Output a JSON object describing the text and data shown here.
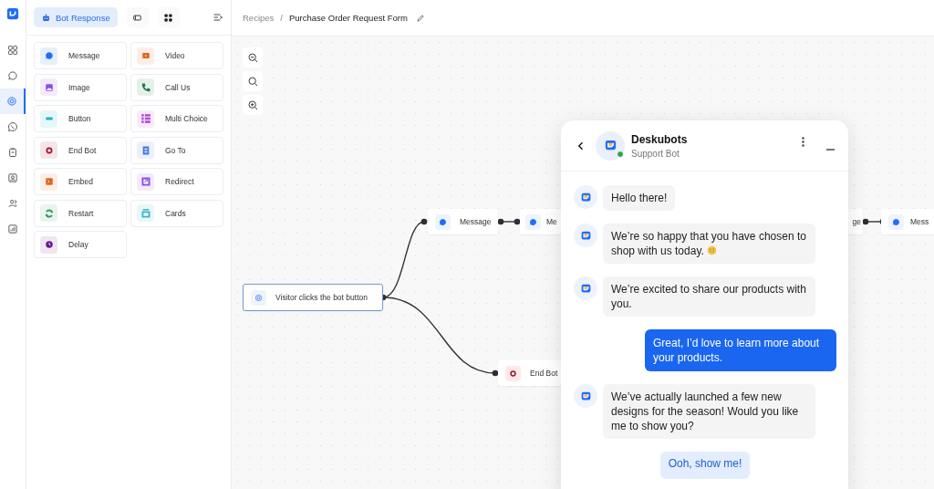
{
  "rail": {
    "items": [
      {
        "kind": "grid",
        "selected": false
      },
      {
        "kind": "chat",
        "selected": false
      },
      {
        "kind": "bot",
        "selected": true
      },
      {
        "kind": "whatsapp",
        "selected": false
      },
      {
        "kind": "clipboard",
        "selected": false
      },
      {
        "kind": "contact",
        "selected": false
      },
      {
        "kind": "people",
        "selected": false
      },
      {
        "kind": "chart",
        "selected": false
      }
    ]
  },
  "panel": {
    "tabs": [
      {
        "kind": "label",
        "label": "Bot Response",
        "selected": true
      },
      {
        "kind": "layout",
        "selected": false
      },
      {
        "kind": "grid",
        "selected": false
      }
    ],
    "blocks": [
      {
        "kind": "message",
        "label": "Message",
        "color": "#1e6ff5"
      },
      {
        "kind": "video",
        "label": "Video",
        "color": "#e0661c"
      },
      {
        "kind": "image",
        "label": "Image",
        "color": "#8a4df0"
      },
      {
        "kind": "call",
        "label": "Call Us",
        "color": "#1a7a45"
      },
      {
        "kind": "button",
        "label": "Button",
        "color": "#18b5c4"
      },
      {
        "kind": "choice",
        "label": "Multi Choice",
        "color": "#b64bd6"
      },
      {
        "kind": "end",
        "label": "End Bot",
        "color": "#a3122a"
      },
      {
        "kind": "goto",
        "label": "Go To",
        "color": "#4a7be0"
      },
      {
        "kind": "embed",
        "label": "Embed",
        "color": "#e0661c"
      },
      {
        "kind": "redirect",
        "label": "Redirect",
        "color": "#8a4df0"
      },
      {
        "kind": "restart",
        "label": "Restart",
        "color": "#2f9a5a"
      },
      {
        "kind": "cards",
        "label": "Cards",
        "color": "#3ab8c8"
      },
      {
        "kind": "delay",
        "label": "Delay",
        "color": "#6a1a8a"
      }
    ]
  },
  "breadcrumb": {
    "separator": "/",
    "items": [
      "Recipes",
      "Purchase Order Request Form"
    ]
  },
  "canvas": {
    "nodes": [
      {
        "kind": "trigger",
        "label": "Visitor clicks the bot button",
        "selected": true
      },
      {
        "kind": "message",
        "label": "Message",
        "selected": false
      },
      {
        "kind": "message",
        "label": "Me",
        "selected": false
      },
      {
        "label": "ge",
        "selected": false
      },
      {
        "kind": "message",
        "label": "Mess",
        "selected": false
      },
      {
        "kind": "end",
        "label": "End Bot",
        "selected": false
      }
    ]
  },
  "chat": {
    "title": "Deskubots",
    "subtitle": "Support Bot",
    "online": true,
    "messages": [
      {
        "kind": "bot",
        "text": "Hello there!"
      },
      {
        "kind": "bot",
        "text": "We’re so happy that you have chosen to shop with us today.",
        "emoji": true
      },
      {
        "kind": "bot",
        "text": "We’re excited to share our products with you."
      },
      {
        "kind": "user",
        "text": "Great, I’d love to learn more about your products."
      },
      {
        "kind": "bot",
        "text": "We’ve actually launched a few new designs for the season! Would you like me to show you?"
      },
      {
        "kind": "quick_reply",
        "text": "Ooh, show me!"
      }
    ]
  }
}
